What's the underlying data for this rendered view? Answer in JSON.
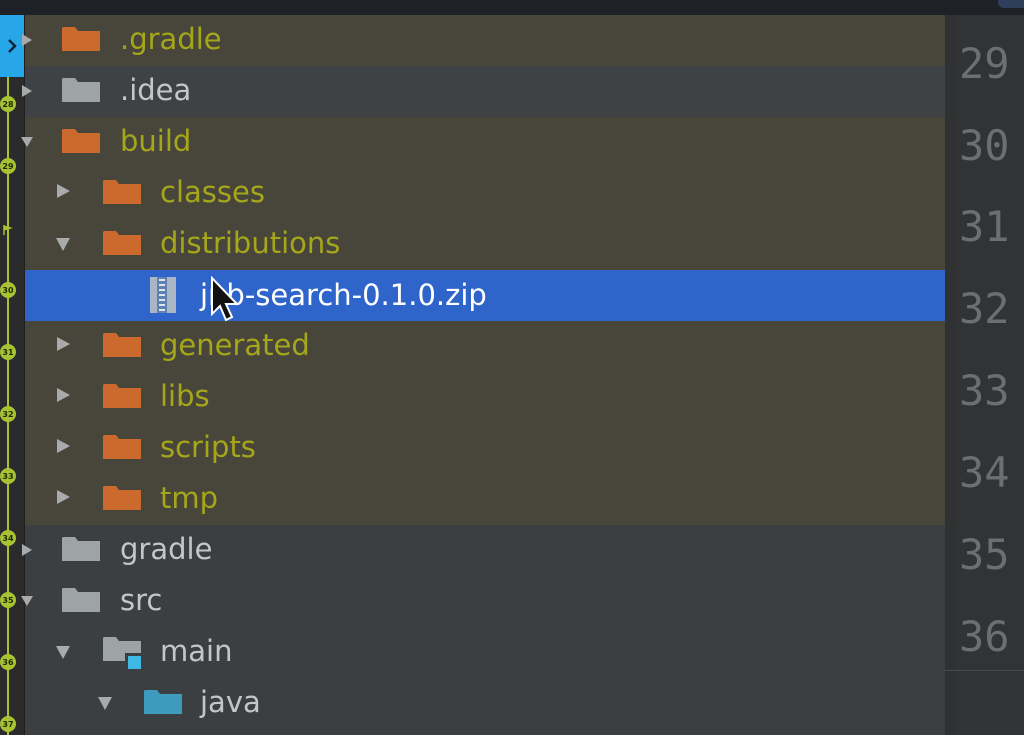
{
  "gutter": {
    "markers": [
      "28",
      "29",
      "30",
      "31",
      "32",
      "33",
      "34",
      "35",
      "36",
      "37"
    ]
  },
  "tree": {
    "items": [
      {
        "label": ".gradle",
        "expanded": false,
        "color": "#a5a61a",
        "icon": "folder-orange-icon"
      },
      {
        "label": ".idea",
        "expanded": false,
        "color": "#c4c7c8",
        "icon": "folder-grey-icon"
      },
      {
        "label": "build",
        "expanded": true,
        "color": "#a5a61a",
        "icon": "folder-orange-icon"
      },
      {
        "label": "classes",
        "expanded": false,
        "color": "#a5a61a",
        "icon": "folder-orange-icon"
      },
      {
        "label": "distributions",
        "expanded": true,
        "color": "#a5a61a",
        "icon": "folder-orange-icon"
      },
      {
        "label": "jnb-search-0.1.0.zip",
        "selected": true,
        "color": "#ffffff",
        "icon": "zip-archive-icon"
      },
      {
        "label": "generated",
        "expanded": false,
        "color": "#a5a61a",
        "icon": "folder-orange-icon"
      },
      {
        "label": "libs",
        "expanded": false,
        "color": "#a5a61a",
        "icon": "folder-orange-icon"
      },
      {
        "label": "scripts",
        "expanded": false,
        "color": "#a5a61a",
        "icon": "folder-orange-icon"
      },
      {
        "label": "tmp",
        "expanded": false,
        "color": "#a5a61a",
        "icon": "folder-orange-icon"
      },
      {
        "label": "gradle",
        "expanded": false,
        "color": "#c4c7c8",
        "icon": "folder-grey-icon"
      },
      {
        "label": "src",
        "expanded": true,
        "color": "#c4c7c8",
        "icon": "folder-grey-icon"
      },
      {
        "label": "main",
        "expanded": true,
        "color": "#c4c7c8",
        "icon": "module-folder-icon"
      },
      {
        "label": "java",
        "expanded": true,
        "color": "#c4c7c8",
        "icon": "source-folder-icon"
      }
    ]
  },
  "editor": {
    "line_numbers": [
      "29",
      "30",
      "31",
      "32",
      "33",
      "34",
      "35",
      "36"
    ]
  },
  "colors": {
    "selection": "#2f65ca",
    "excluded_bg": "#48463a",
    "excluded_text": "#a5a61a",
    "folder_orange": "#cc6a2e",
    "folder_grey": "#9ea3a6",
    "source_blue": "#3d9bbd",
    "marker_green": "#a9c234"
  }
}
